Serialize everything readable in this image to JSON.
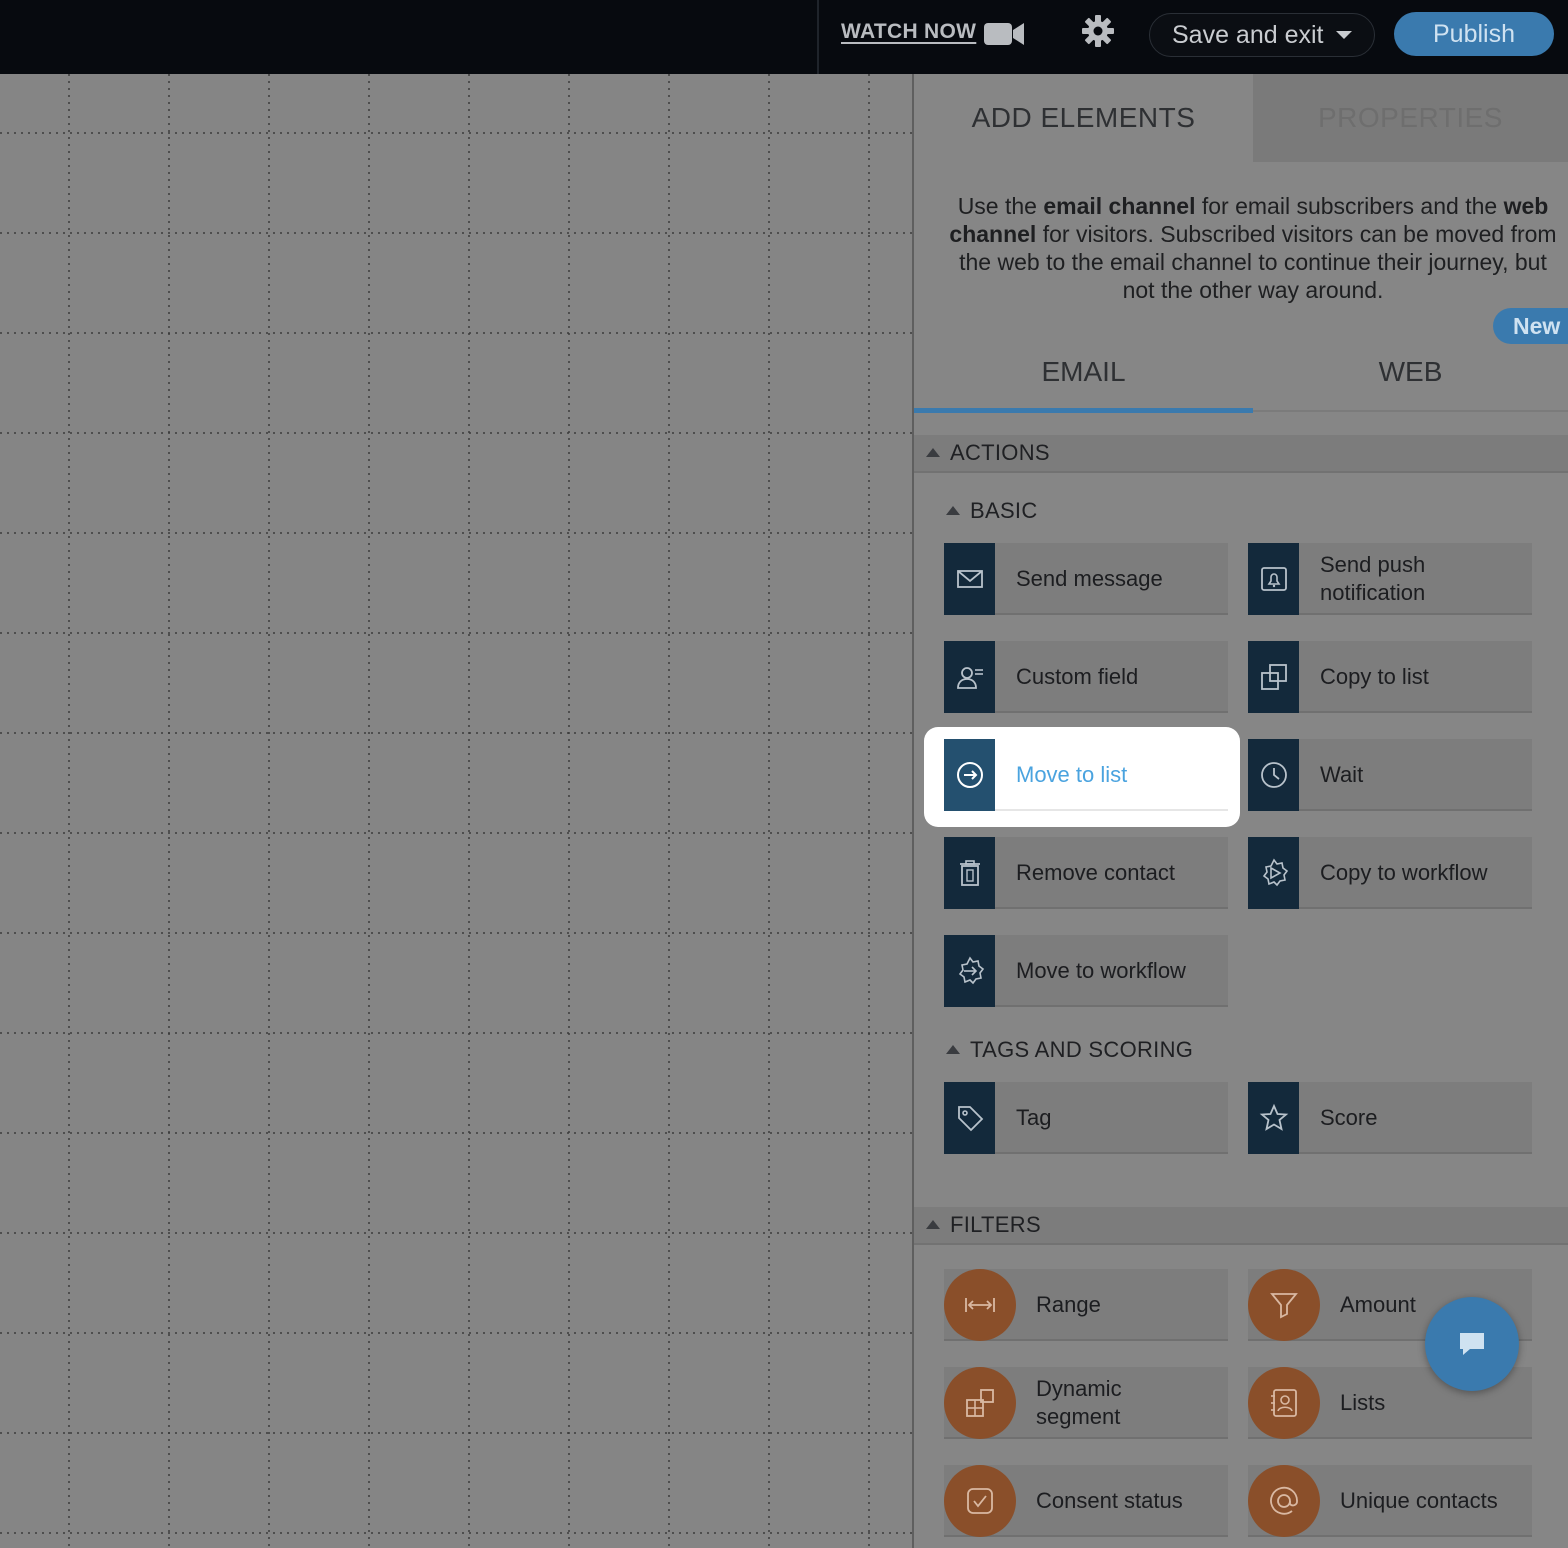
{
  "topbar": {
    "watch_now": "WATCH NOW",
    "save_exit": "Save and exit",
    "publish": "Publish"
  },
  "panel": {
    "tab_add": "ADD ELEMENTS",
    "tab_properties": "PROPERTIES",
    "intro": {
      "p1": "Use the ",
      "b1": "email channel",
      "p2": " for email subscribers and the ",
      "b2": "web channel",
      "p3": " for visitors. Subscribed visitors can be moved from the web to the email channel to continue their journey, but not the other way around."
    },
    "new_badge": "New",
    "channel_email": "EMAIL",
    "channel_web": "WEB"
  },
  "actions": {
    "section": "ACTIONS",
    "basic": {
      "heading": "BASIC",
      "items": [
        {
          "label": "Send message",
          "icon": "envelope-icon"
        },
        {
          "label": "Send push notification",
          "icon": "push-notification-icon"
        },
        {
          "label": "Custom field",
          "icon": "user-field-icon"
        },
        {
          "label": "Copy to list",
          "icon": "copy-icon"
        },
        {
          "label": "Move to list",
          "icon": "arrow-circle-icon"
        },
        {
          "label": "Wait",
          "icon": "clock-icon"
        },
        {
          "label": "Remove contact",
          "icon": "trash-icon"
        },
        {
          "label": "Copy to workflow",
          "icon": "gear-play-icon"
        },
        {
          "label": "Move to workflow",
          "icon": "gear-arrow-icon"
        }
      ]
    },
    "tags": {
      "heading": "TAGS AND SCORING",
      "items": [
        {
          "label": "Tag",
          "icon": "tag-icon"
        },
        {
          "label": "Score",
          "icon": "star-icon"
        }
      ]
    }
  },
  "filters": {
    "section": "FILTERS",
    "items": [
      {
        "label": "Range",
        "icon": "range-icon"
      },
      {
        "label": "Amount",
        "icon": "funnel-icon"
      },
      {
        "label": "Dynamic segment",
        "icon": "segment-icon"
      },
      {
        "label": "Lists",
        "icon": "contact-book-icon"
      },
      {
        "label": "Consent status",
        "icon": "checkbox-icon"
      },
      {
        "label": "Unique contacts",
        "icon": "at-icon"
      }
    ]
  },
  "colors": {
    "accent": "#3a7aae",
    "action_icon_bg": "#13293b",
    "filter_circle": "#8a4f2a",
    "highlight_text": "#4aa3df"
  }
}
